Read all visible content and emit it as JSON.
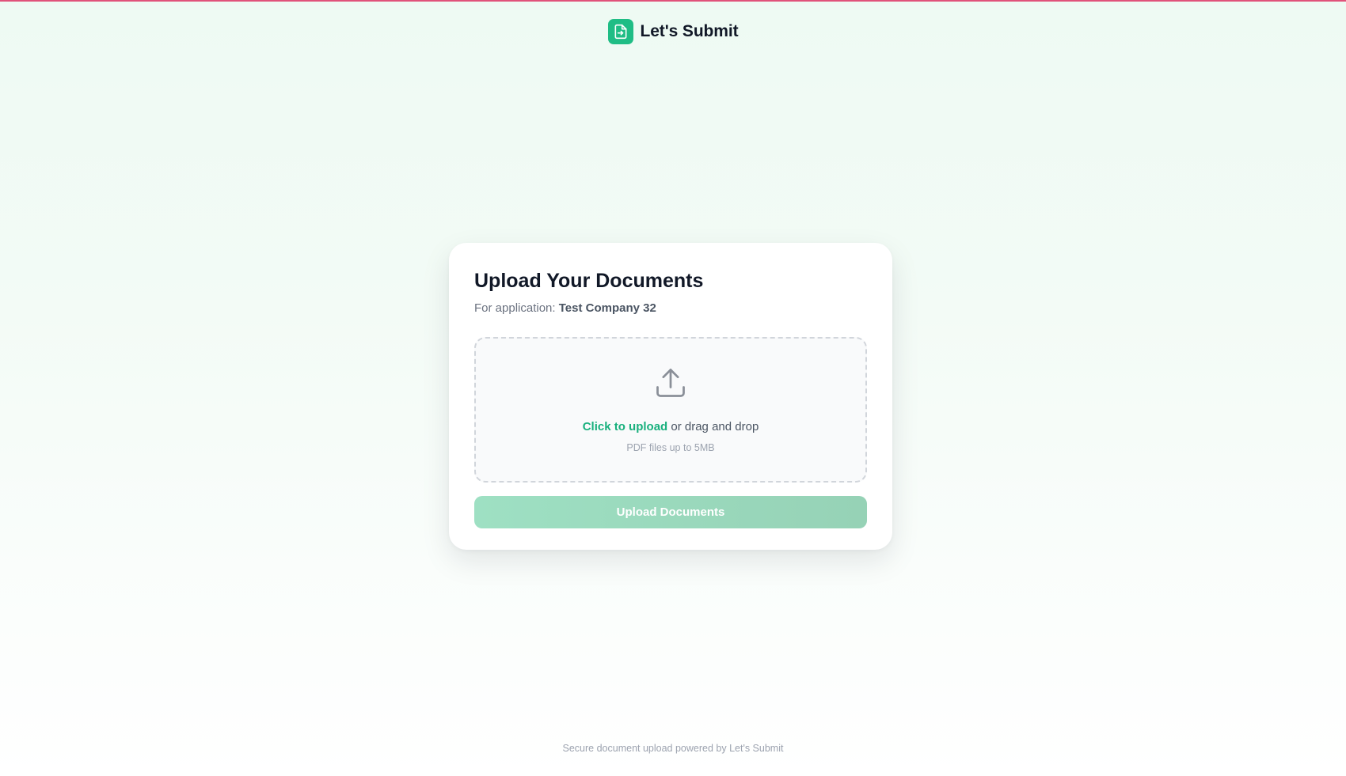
{
  "header": {
    "logo_icon": "document-arrow-icon",
    "brand": "Let's Submit"
  },
  "card": {
    "title": "Upload Your Documents",
    "subtitle_prefix": "For application:",
    "company": "Test Company 32"
  },
  "dropzone": {
    "icon": "upload-icon",
    "click_text": "Click to upload",
    "drag_text": "or drag and drop",
    "hint": "PDF files up to 5MB"
  },
  "submit": {
    "label": "Upload Documents",
    "disabled": true
  },
  "footer": {
    "text": "Secure document upload powered by Let's Submit"
  },
  "colors": {
    "accent": "#1fbd85",
    "top_bar": "#e0527a"
  }
}
